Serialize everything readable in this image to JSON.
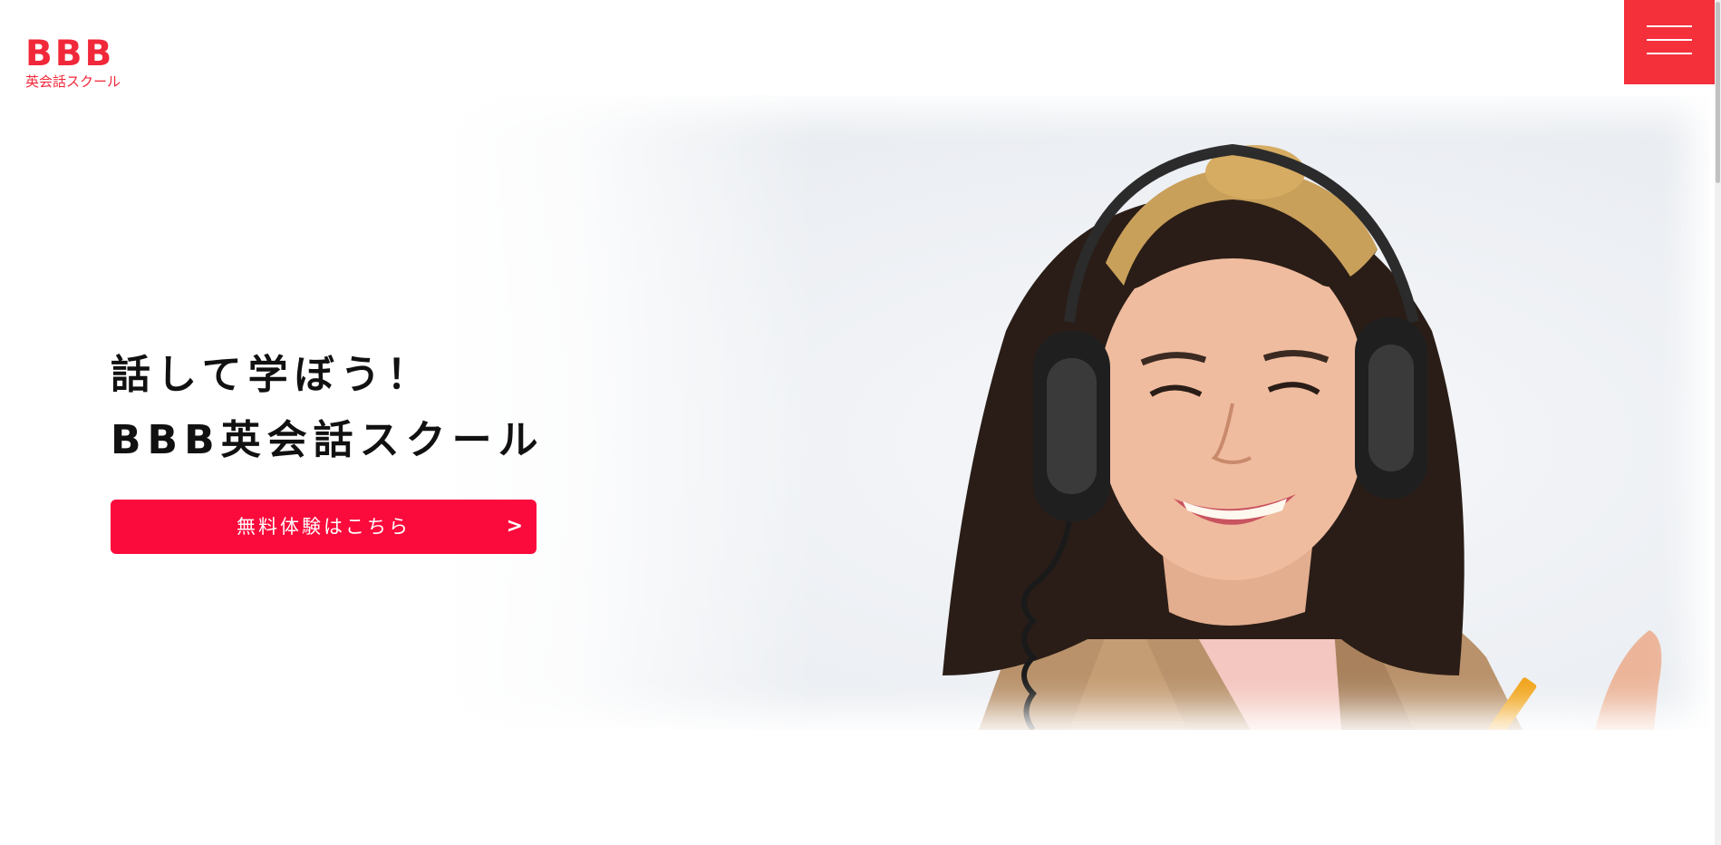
{
  "header": {
    "logo_mark": "BBB",
    "logo_sub": "英会話スクール",
    "menu_icon": "hamburger-icon"
  },
  "hero": {
    "headline_line1": "話して学ぼう！",
    "headline_line2": "BBB英会話スクール",
    "cta_label": "無料体験はこちら",
    "cta_arrow": ">",
    "photo_subject": "smiling woman wearing headphones"
  },
  "colors": {
    "brand": "#f0283a",
    "cta": "#fb0a3c",
    "text": "#111111"
  }
}
